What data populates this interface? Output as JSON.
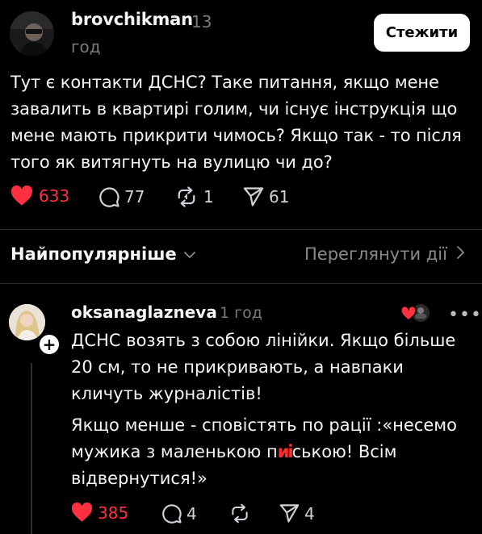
{
  "post": {
    "username": "brovchikman",
    "time_num": "13",
    "time_unit": "год",
    "follow_label": "Стежити",
    "text": "Тут є контакти ДСНС? Таке питання, якщо мене завалить в квартирі голим, чи існує інструкція що мене мають прикрити чимось? Якщо так - то після того як витягнуть на вулицю чи до?",
    "likes": "633",
    "comments": "77",
    "reposts": "1",
    "shares": "61"
  },
  "sort_bar": {
    "sort_label": "Найпопулярніше",
    "activity_label": "Переглянути дії"
  },
  "reply": {
    "username": "oksanaglazneva",
    "time": "1 год",
    "para1": "ДСНС возять з собою лінійки. Якщо більше 20 см, то не прикривають, а навпаки кличуть журналістів!",
    "para2_before": "Якщо менше - сповістять по рації :«несемо мужика з маленькою п",
    "para2_scribble": "иi",
    "para2_after": "ською! Всім відвернутися!»",
    "likes": "385",
    "comments": "4",
    "shares": "4"
  },
  "colors": {
    "background": "#000000",
    "like_red": "#ff3040",
    "text": "#f3f5f7",
    "muted": "#7a7a7a"
  },
  "icons": {
    "like": "heart-icon",
    "comment": "comment-bubble-icon",
    "repost": "repost-icon",
    "share": "paper-plane-icon",
    "sort": "chevron-down-icon",
    "activity": "chevron-right-icon",
    "more": "more-dots-icon"
  }
}
